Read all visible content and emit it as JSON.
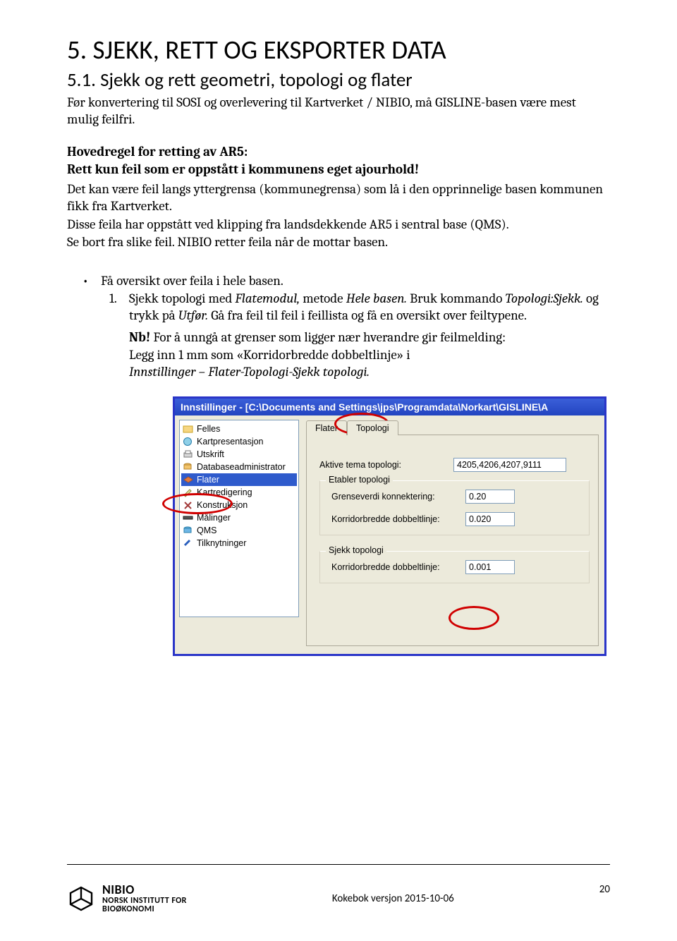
{
  "h1": "5. SJEKK, RETT OG EKSPORTER DATA",
  "h2": "5.1. Sjekk og rett geometri, topologi og flater",
  "intro": "Før konvertering til SOSI og overlevering til Kartverket / NIBIO, må GISLINE-basen være mest mulig feilfri.",
  "rule": {
    "line1": "Hovedregel for retting av AR5:",
    "line2": "Rett kun feil som er oppstått i kommunens eget ajourhold!",
    "p1": "Det kan være feil langs yttergrensa (kommunegrensa) som lå i den opprinnelige basen kommunen fikk fra Kartverket.",
    "p2": "Disse feila har oppstått ved klipping fra landsdekkende AR5 i sentral base (QMS).",
    "p3": "Se bort fra slike feil. NIBIO retter feila når de mottar basen."
  },
  "bullet1": "Få oversikt over feila i hele basen.",
  "step1_a": "Sjekk topologi med ",
  "step1_b_i": "Flatemodul,",
  "step1_c": " metode ",
  "step1_d_i": "Hele basen. ",
  "step1_e": "Bruk kommando ",
  "step1_f_i": "Topologi:Sjekk.",
  "step1_g": " og trykk på ",
  "step1_h_i": "Utfør.",
  "step1_i": " Gå fra feil til feil i feillista og få en oversikt over feiltypene.",
  "note_nb": "Nb!",
  "note_rest": " For å unngå at grenser som ligger nær hverandre gir feilmelding:",
  "note_l2": "Legg inn 1 mm som «Korridorbredde dobbeltlinje» i",
  "note_l3_i": "Innstillinger – Flater-Topologi-Sjekk topologi.",
  "shot": {
    "title": "Innstillinger - [C:\\Documents and Settings\\jps\\Programdata\\Norkart\\GISLINE\\A",
    "tree": [
      "Felles",
      "Kartpresentasjon",
      "Utskrift",
      "Databaseadministrator",
      "Flater",
      "Kartredigering",
      "Konstruksjon",
      "Målinger",
      "QMS",
      "Tilknytninger"
    ],
    "tab1": "Flater",
    "tab2": "Topologi",
    "f_active_label": "Aktive tema topologi:",
    "f_active_val": "4205,4206,4207,9111",
    "grp_establish": "Etabler topologi",
    "f_grense_label": "Grenseverdi konnektering:",
    "f_grense_val": "0.20",
    "f_korr1_label": "Korridorbredde dobbeltlinje:",
    "f_korr1_val": "0.020",
    "grp_check": "Sjekk topologi",
    "f_korr2_label": "Korridorbredde dobbeltlinje:",
    "f_korr2_val": "0.001"
  },
  "footer": {
    "brand": "NIBIO",
    "sub1": "NORSK INSTITUTT FOR",
    "sub2": "BIOØKONOMI",
    "center": "Kokebok versjon 2015-10-06",
    "page": "20"
  }
}
